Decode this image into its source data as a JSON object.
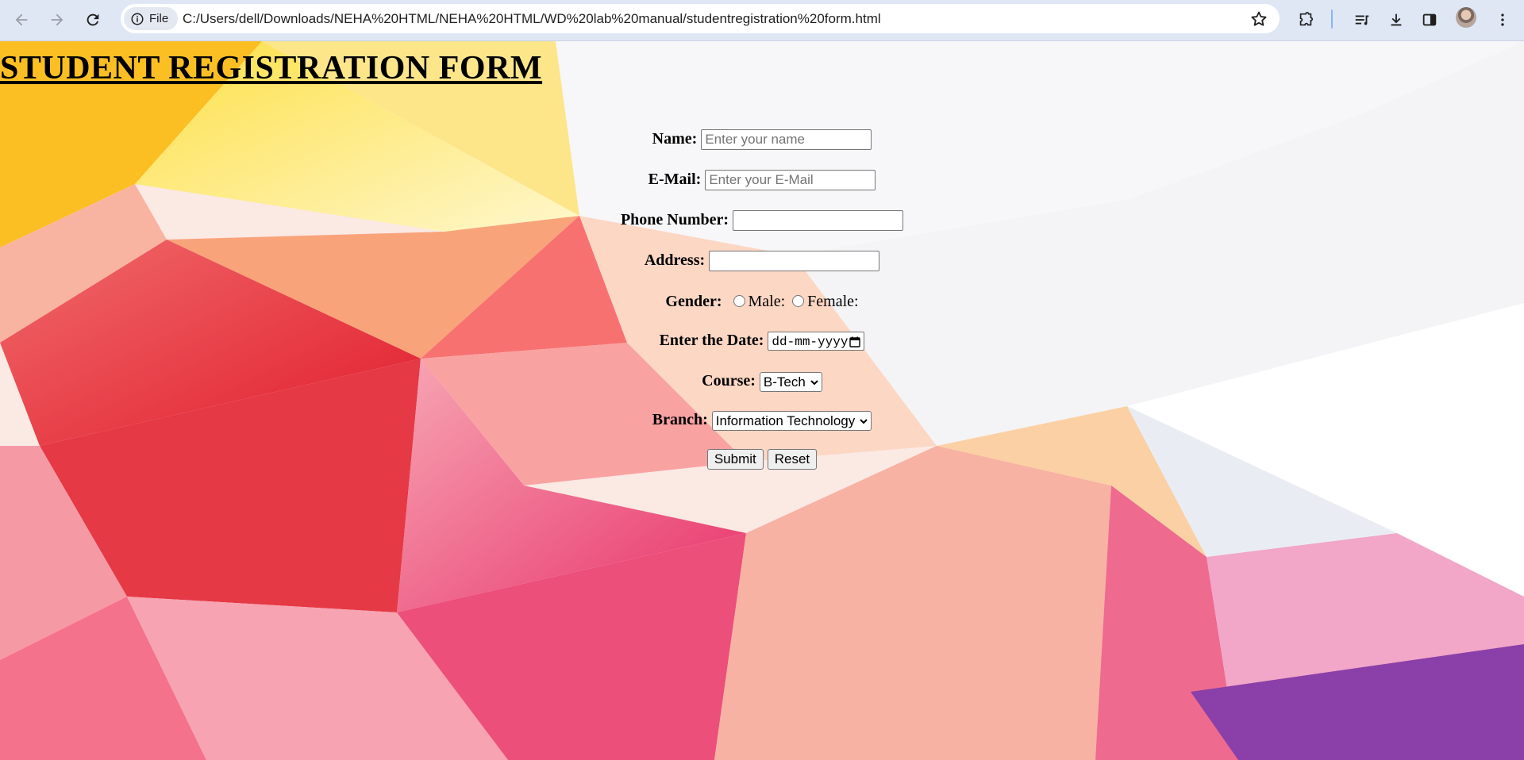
{
  "browser": {
    "site_chip": "File",
    "url": "C:/Users/dell/Downloads/NEHA%20HTML/NEHA%20HTML/WD%20lab%20manual/studentregistration%20form.html"
  },
  "form": {
    "title": "STUDENT REGISTRATION FORM",
    "name_label": "Name:",
    "name_placeholder": "Enter your name",
    "email_label": "E-Mail:",
    "email_placeholder": "Enter your E-Mail",
    "phone_label": "Phone Number:",
    "address_label": "Address:",
    "gender_label": "Gender:",
    "gender_male": "Male:",
    "gender_female": "Female:",
    "date_label": "Enter the Date:",
    "date_value": "dd-mm-yyyy",
    "course_label": "Course:",
    "course_selected": "B-Tech",
    "branch_label": "Branch:",
    "branch_selected": "Information Technology",
    "submit_label": "Submit",
    "reset_label": "Reset"
  },
  "icons": {
    "back": "arrow-left-icon",
    "forward": "arrow-right-icon",
    "reload": "reload-icon",
    "info": "info-icon",
    "bookmark": "star-icon",
    "extensions": "puzzle-icon",
    "media": "media-queue-icon",
    "downloads": "download-icon",
    "side_panel": "side-panel-icon",
    "profile": "avatar",
    "menu": "kebab-menu-icon"
  },
  "colors": {
    "chrome_bg": "#dfe7f5",
    "background_theme": "polygon gradient red-pink-yellow"
  }
}
